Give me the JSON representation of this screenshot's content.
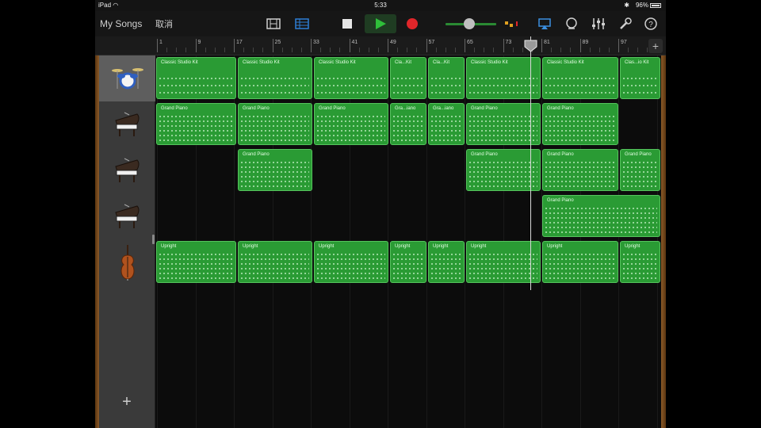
{
  "status_bar": {
    "carrier": "iPad",
    "time": "5:33",
    "battery": "96%"
  },
  "toolbar": {
    "my_songs": "My Songs",
    "undo": "取消"
  },
  "ruler": {
    "bars": [
      "1",
      "9",
      "17",
      "25",
      "33",
      "41",
      "49",
      "57",
      "65",
      "73",
      "81",
      "89",
      "97"
    ],
    "add_label": "+"
  },
  "tracks": [
    {
      "instrument": "drums",
      "icon": "drum-kit-icon",
      "selected": true,
      "regions": [
        {
          "name": "Classic Studio Kit",
          "start": 0,
          "end": 103
        },
        {
          "name": "Classic Studio Kit",
          "start": 103,
          "end": 199
        },
        {
          "name": "Classic Studio Kit",
          "start": 199,
          "end": 295
        },
        {
          "name": "Cla...Kit",
          "start": 295,
          "end": 343
        },
        {
          "name": "Cla...Kit",
          "start": 343,
          "end": 391
        },
        {
          "name": "Classic Studio Kit",
          "start": 391,
          "end": 487
        },
        {
          "name": "Classic Studio Kit",
          "start": 487,
          "end": 585
        },
        {
          "name": "Clas...io Kit",
          "start": 585,
          "end": 638
        }
      ]
    },
    {
      "instrument": "piano",
      "icon": "grand-piano-icon",
      "selected": false,
      "regions": [
        {
          "name": "Grand Piano",
          "start": 0,
          "end": 103
        },
        {
          "name": "Grand Piano",
          "start": 103,
          "end": 199
        },
        {
          "name": "Grand Piano",
          "start": 199,
          "end": 295
        },
        {
          "name": "Gra...iano",
          "start": 295,
          "end": 343
        },
        {
          "name": "Gra...iano",
          "start": 343,
          "end": 391
        },
        {
          "name": "Grand Piano",
          "start": 391,
          "end": 487
        },
        {
          "name": "Grand Piano",
          "start": 487,
          "end": 585
        }
      ]
    },
    {
      "instrument": "piano",
      "icon": "grand-piano-icon",
      "selected": false,
      "regions": [
        {
          "name": "Grand Piano",
          "start": 103,
          "end": 199
        },
        {
          "name": "Grand Piano",
          "start": 391,
          "end": 487
        },
        {
          "name": "Grand Piano",
          "start": 487,
          "end": 585
        },
        {
          "name": "Grand Piano",
          "start": 585,
          "end": 638
        }
      ]
    },
    {
      "instrument": "piano",
      "icon": "grand-piano-icon",
      "selected": false,
      "regions": [
        {
          "name": "Grand Piano",
          "start": 487,
          "end": 638
        }
      ]
    },
    {
      "instrument": "upright bass",
      "icon": "upright-bass-icon",
      "selected": false,
      "regions": [
        {
          "name": "Upright",
          "start": 0,
          "end": 103
        },
        {
          "name": "Upright",
          "start": 103,
          "end": 199
        },
        {
          "name": "Upright",
          "start": 199,
          "end": 295
        },
        {
          "name": "Upright",
          "start": 295,
          "end": 343
        },
        {
          "name": "Upright",
          "start": 343,
          "end": 391
        },
        {
          "name": "Upright",
          "start": 391,
          "end": 487
        },
        {
          "name": "Upright",
          "start": 487,
          "end": 585
        },
        {
          "name": "Upright",
          "start": 585,
          "end": 638
        }
      ]
    }
  ],
  "add_track_label": "+",
  "colors": {
    "region": "#2a9b34",
    "region_border": "#55c45d",
    "play_accent": "#2fbf3a",
    "record": "#e0262a",
    "tracks_view_accent": "#2d7fd6"
  }
}
